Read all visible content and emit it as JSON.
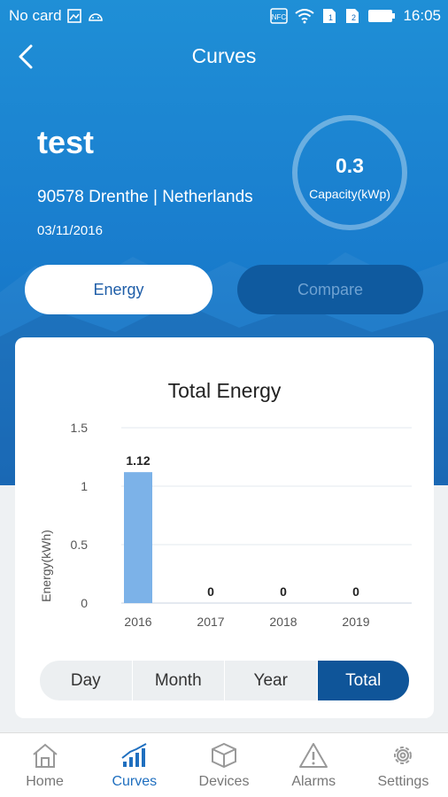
{
  "statusbar": {
    "carrier": "No card",
    "nfc": "NFC",
    "time": "16:05"
  },
  "header": {
    "title": "Curves"
  },
  "plant": {
    "name": "test",
    "location": "90578 Drenthe | Netherlands",
    "date": "03/11/2016",
    "capacity_value": "0.3",
    "capacity_label": "Capacity(kWp)"
  },
  "segments": {
    "energy": "Energy",
    "compare": "Compare",
    "active": "energy"
  },
  "chart_data": {
    "type": "bar",
    "title": "Total Energy",
    "ylabel": "Energy(kWh)",
    "xlabel": "",
    "categories": [
      "2016",
      "2017",
      "2018",
      "2019"
    ],
    "values": [
      1.12,
      0,
      0,
      0
    ],
    "value_labels": [
      "1.12",
      "0",
      "0",
      "0"
    ],
    "yticks": [
      "0",
      "0.5",
      "1",
      "1.5"
    ],
    "ylim": [
      0,
      1.5
    ],
    "grid": true,
    "bar_color": "#7cb2e8"
  },
  "period_tabs": [
    {
      "label": "Day"
    },
    {
      "label": "Month"
    },
    {
      "label": "Year"
    },
    {
      "label": "Total"
    }
  ],
  "period_active": "Total",
  "bottom_nav": [
    {
      "label": "Home",
      "icon": "home-icon"
    },
    {
      "label": "Curves",
      "icon": "curves-icon"
    },
    {
      "label": "Devices",
      "icon": "devices-icon"
    },
    {
      "label": "Alarms",
      "icon": "alarm-icon"
    },
    {
      "label": "Settings",
      "icon": "settings-icon"
    }
  ],
  "bottom_nav_active": "Curves",
  "colors": {
    "accent": "#0f5599",
    "hero": "#1a7fcf",
    "bar": "#7cb2e8"
  }
}
